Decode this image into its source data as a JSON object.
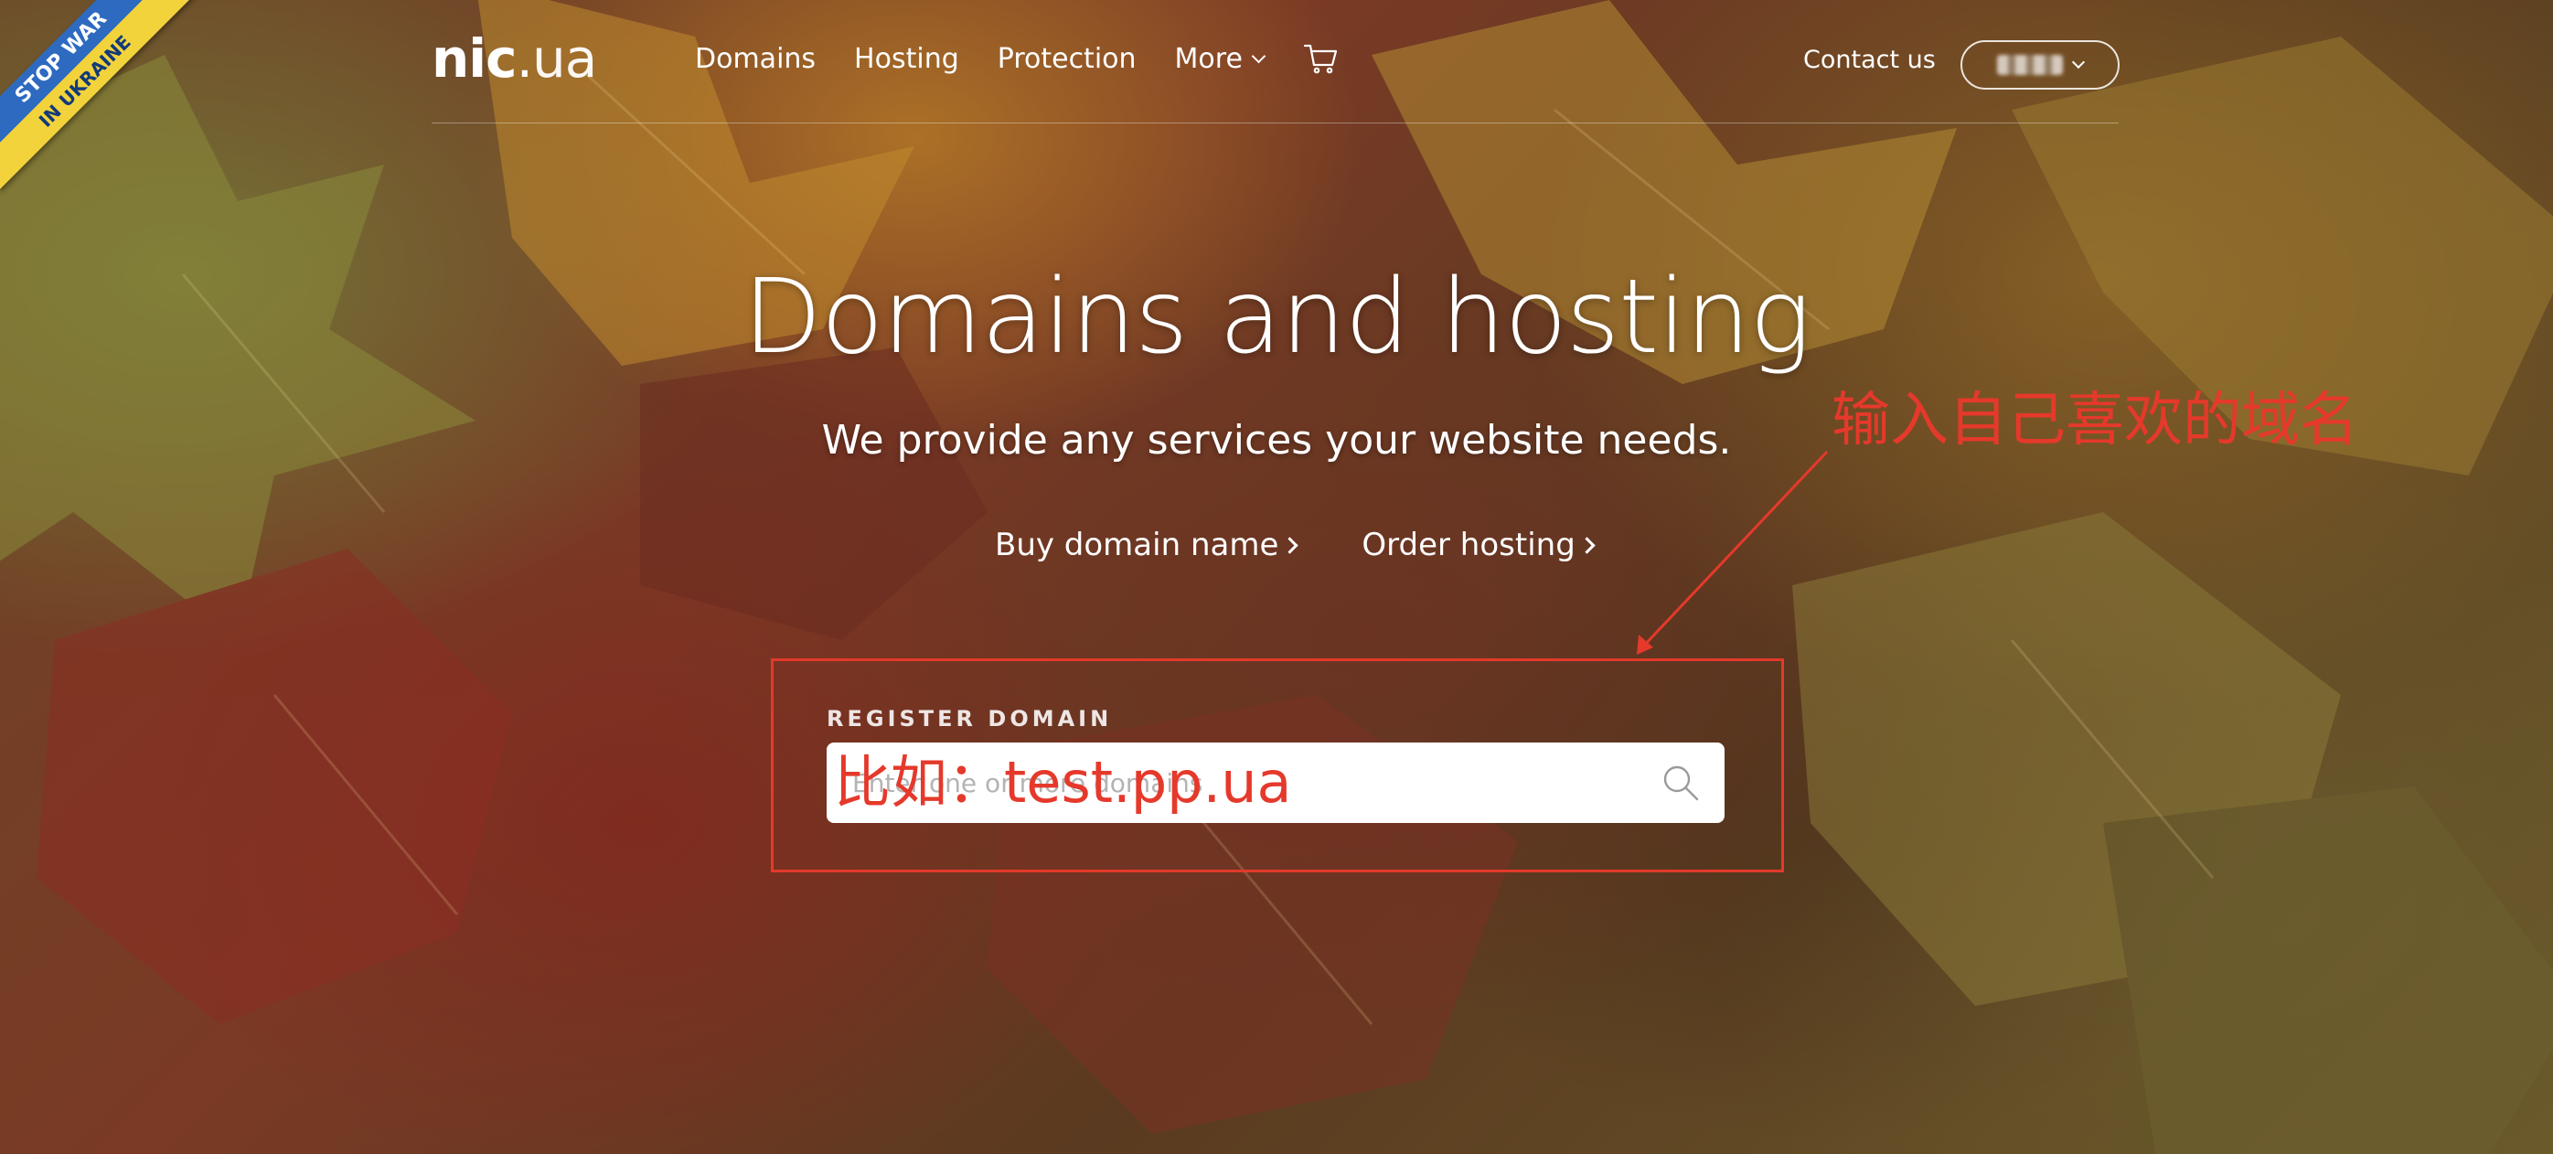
{
  "ribbon": {
    "line1": "STOP WAR",
    "line2": "IN UKRAINE"
  },
  "logo": {
    "bold": "nic",
    "dot": ".",
    "rest": "ua"
  },
  "nav": {
    "items": [
      "Domains",
      "Hosting",
      "Protection"
    ],
    "more": "More"
  },
  "header": {
    "contact": "Contact us"
  },
  "hero": {
    "title": "Domains and hosting",
    "subtitle": "We provide any services your website needs.",
    "cta_buy": "Buy domain name",
    "cta_order": "Order hosting"
  },
  "register": {
    "label": "REGISTER DOMAIN",
    "placeholder": "Enter one or more domains"
  },
  "annotations": {
    "hint": "输入自己喜欢的域名",
    "example": "比如：test.pp.ua",
    "color": "#e5392b"
  }
}
